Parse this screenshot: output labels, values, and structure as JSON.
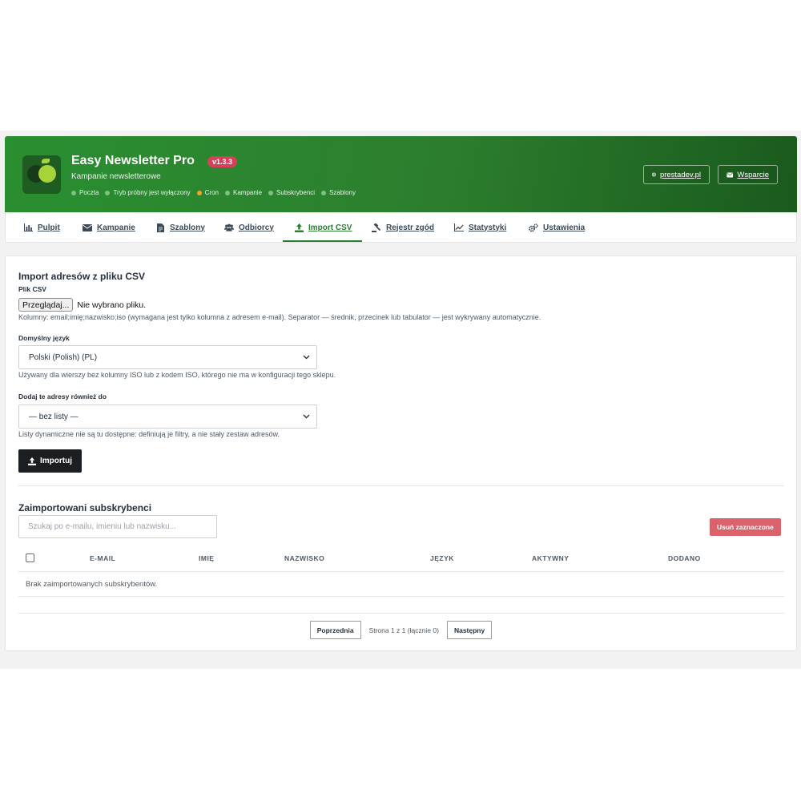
{
  "header": {
    "title": "Easy Newsletter Pro",
    "version": "v1.3.3",
    "subtitle": "Kampanie newsletterowe",
    "status": [
      {
        "label": "Poczta",
        "color": "#7dc27f"
      },
      {
        "label": "Tryb próbny jest wyłączony",
        "color": "#7dc27f"
      },
      {
        "label": "Cron",
        "color": "#f0a42b"
      },
      {
        "label": "Kampanie",
        "color": "#7dc27f"
      },
      {
        "label": "Subskrybenci",
        "color": "#7dc27f"
      },
      {
        "label": "Szablony",
        "color": "#7dc27f"
      }
    ],
    "site_link": "prestadev.pl",
    "support_link": "Wsparcie"
  },
  "nav": {
    "items": [
      {
        "label": "Pulpit",
        "icon": "chart-bar-icon"
      },
      {
        "label": "Kampanie",
        "icon": "envelope-icon"
      },
      {
        "label": "Szablony",
        "icon": "file-icon"
      },
      {
        "label": "Odbiorcy",
        "icon": "users-icon"
      },
      {
        "label": "Import CSV",
        "icon": "upload-icon"
      },
      {
        "label": "Rejestr zgód",
        "icon": "gavel-icon"
      },
      {
        "label": "Statystyki",
        "icon": "line-chart-icon"
      },
      {
        "label": "Ustawienia",
        "icon": "gears-icon"
      }
    ],
    "active": "Import CSV"
  },
  "import": {
    "title": "Import adresów z pliku CSV",
    "file_label": "Plik CSV",
    "file_button": "Przeglądaj...",
    "file_status": "Nie wybrano pliku.",
    "columns_help": "Kolumny: email;imię;nazwisko;iso (wymagana jest tylko kolumna z adresem e-mail). Separator — średnik, przecinek lub tabulator — jest wykrywany automatycznie.",
    "language_label": "Domyślny język",
    "language_value": "Polski (Polish) (PL)",
    "language_help": "Używany dla wierszy bez kolumny ISO lub z kodem ISO, którego nie ma w konfiguracji tego sklepu.",
    "list_label": "Dodaj te adresy również do",
    "list_value": "— bez listy —",
    "list_help": "Listy dynamiczne nie są tu dostępne: definiują je filtry, a nie stały zestaw adresów.",
    "import_button": "Importuj"
  },
  "subscribers": {
    "title": "Zaimportowani subskrybenci",
    "search_placeholder": "Szukaj po e-mailu, imieniu lub nazwisku...",
    "delete_button": "Usuń zaznaczone",
    "columns": [
      "E-MAIL",
      "IMIĘ",
      "NAZWISKO",
      "JĘZYK",
      "AKTYWNY",
      "DODANO"
    ],
    "empty": "Brak zaimportowanych subskrybentów.",
    "prev": "Poprzednia",
    "page_info": "Strona 1 z 1 (łącznie 0)",
    "next": "Następny"
  }
}
